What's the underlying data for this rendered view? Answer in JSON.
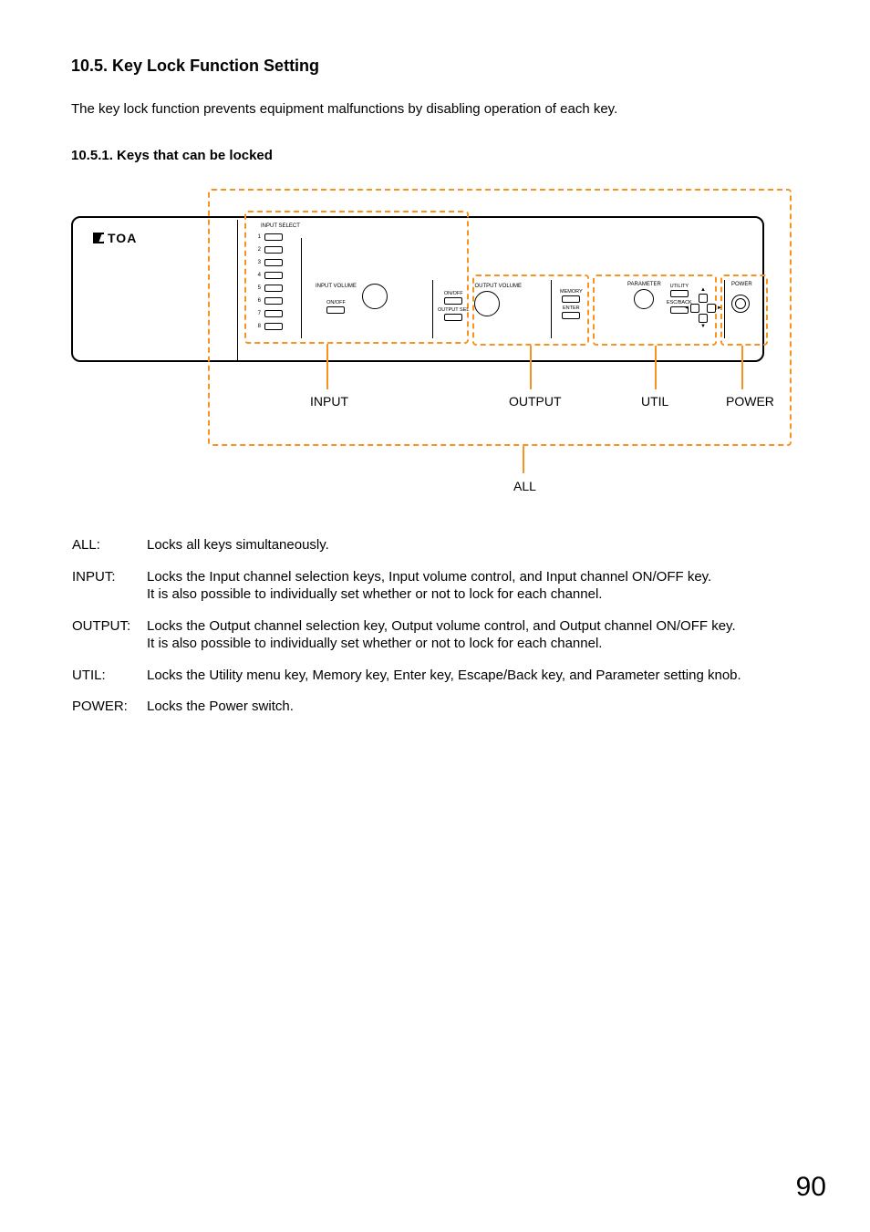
{
  "heading": "10.5. Key Lock Function Setting",
  "intro": "The key lock function prevents equipment malfunctions by disabling operation of each key.",
  "subheading": "10.5.1. Keys that can be locked",
  "panel": {
    "logo": "TOA",
    "input_select": "INPUT SELECT",
    "channels": [
      "1",
      "2",
      "3",
      "4",
      "5",
      "6",
      "7",
      "8"
    ],
    "input_volume": "INPUT VOLUME",
    "onoff": "ON/OFF",
    "output_sel": "OUTPUT SEL",
    "output_volume": "OUTPUT VOLUME",
    "memory": "MEMORY",
    "enter": "ENTER",
    "parameter": "PARAMETER",
    "utility": "UTILITY",
    "escback": "ESC/BACK",
    "power": "POWER"
  },
  "group_labels": {
    "input": "INPUT",
    "output": "OUTPUT",
    "util": "UTIL",
    "power": "POWER",
    "all": "ALL"
  },
  "defs": {
    "all": {
      "term": "ALL:",
      "desc": "Locks all keys simultaneously."
    },
    "input": {
      "term": "INPUT:",
      "desc1": "Locks the Input channel selection keys, Input volume control, and Input channel ON/OFF key.",
      "desc2": "It is also possible to individually set whether or not to lock for each channel."
    },
    "output": {
      "term": "OUTPUT:",
      "desc1": "Locks the Output channel selection key, Output volume control, and Output channel ON/OFF key.",
      "desc2": "It is also possible to individually set whether or not to lock for each channel."
    },
    "util": {
      "term": "UTIL:",
      "desc": "Locks the Utility menu key, Memory key, Enter key, Escape/Back key, and Parameter setting knob."
    },
    "power": {
      "term": "POWER:",
      "desc": "Locks the Power switch."
    }
  },
  "page_number": "90"
}
